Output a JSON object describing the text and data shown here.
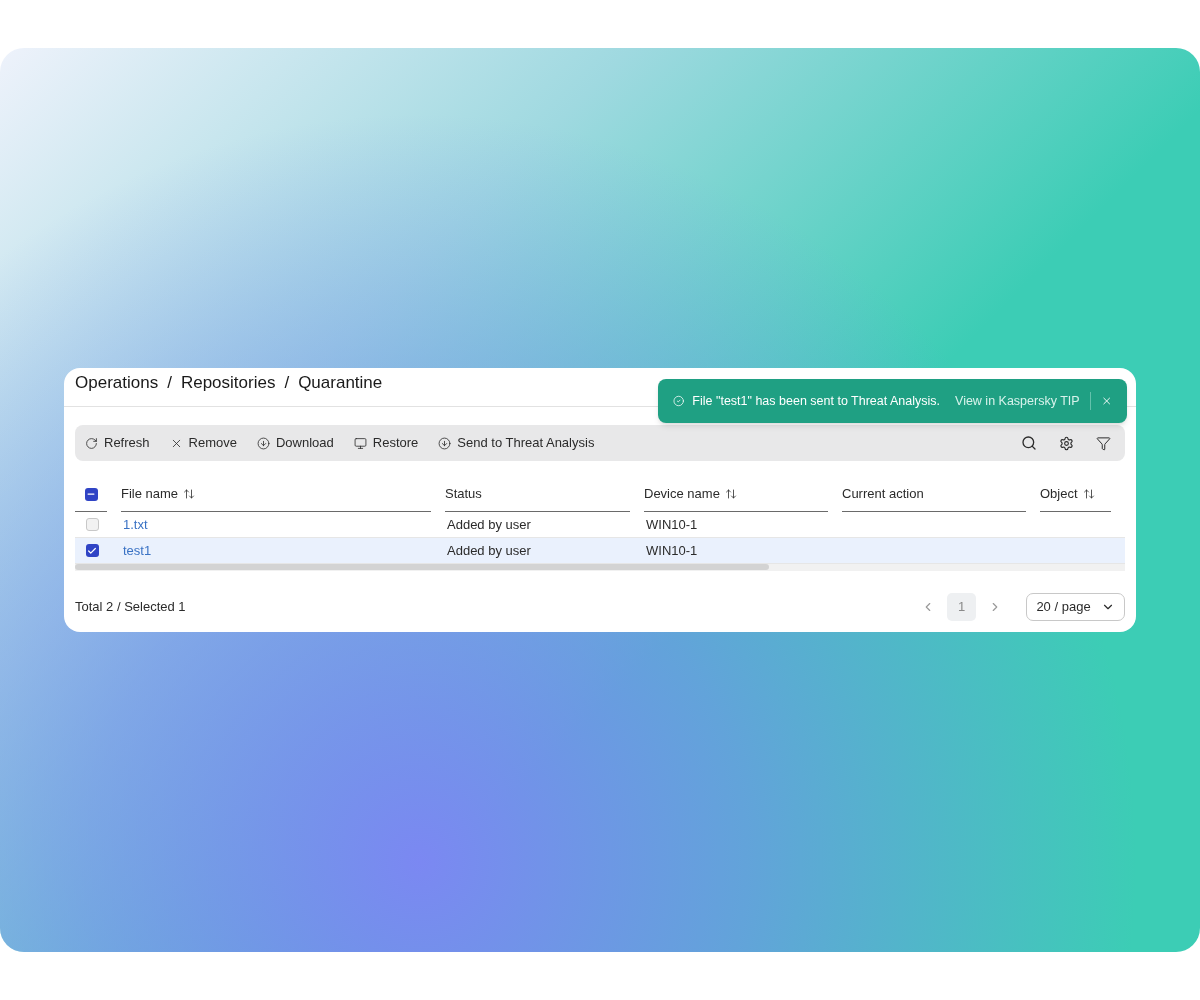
{
  "breadcrumb": [
    "Operations",
    "Repositories",
    "Quarantine"
  ],
  "breadcrumb_separator": "/",
  "toast": {
    "message": "File \"test1\" has been sent to Threat Analysis.",
    "link": "View in Kaspersky TIP"
  },
  "toolbar": [
    {
      "kind": "refresh",
      "label": "Refresh"
    },
    {
      "kind": "remove",
      "label": "Remove"
    },
    {
      "kind": "download",
      "label": "Download"
    },
    {
      "kind": "restore",
      "label": "Restore"
    },
    {
      "kind": "send",
      "label": "Send to Threat Analysis"
    }
  ],
  "table": {
    "select_all_indeterminate": true,
    "columns": [
      {
        "label": "File name",
        "sortable": true
      },
      {
        "label": "Status",
        "sortable": false
      },
      {
        "label": "Device name",
        "sortable": true
      },
      {
        "label": "Current action",
        "sortable": false
      },
      {
        "label": "Object",
        "sortable": true
      }
    ],
    "rows": [
      {
        "selected": false,
        "cells": [
          "1.txt",
          "Added by user",
          "WIN10-1"
        ]
      },
      {
        "selected": true,
        "cells": [
          "test1",
          "Added by user",
          "WIN10-1"
        ]
      }
    ]
  },
  "footer": {
    "summary": "Total 2 / Selected 1",
    "pages": [
      {
        "label": "1",
        "selected": true
      }
    ],
    "page_size": "20 / page"
  }
}
